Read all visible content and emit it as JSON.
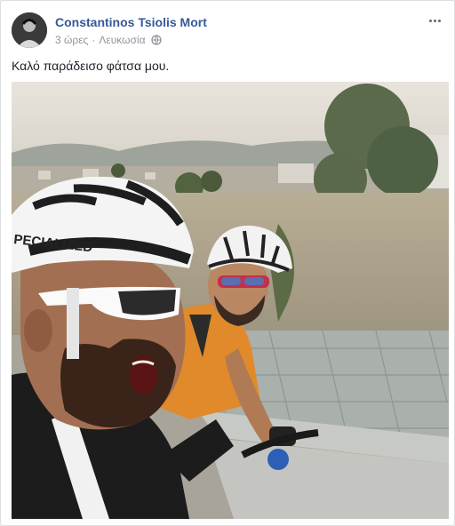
{
  "post": {
    "author": "Constantinos Tsiolis Mort",
    "time": "3 ώρες",
    "separator": "·",
    "location": "Λευκωσία",
    "privacy_icon": "globe-icon",
    "more_icon": "more-options-icon",
    "text": "Καλό παράδεισο φάτσα μου."
  },
  "photo": {
    "helmet_brand": "PECIALIZED"
  }
}
